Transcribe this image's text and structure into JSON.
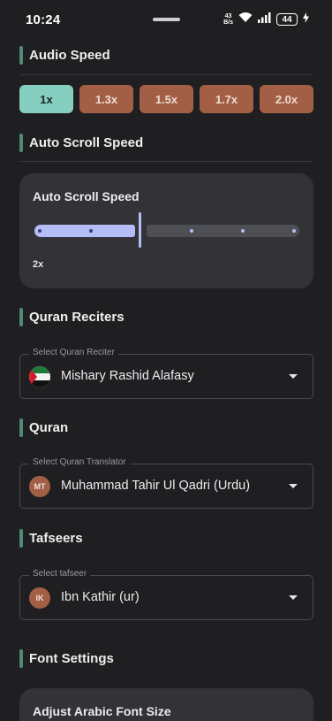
{
  "status_bar": {
    "time": "10:24",
    "net_speed_value": "43",
    "net_speed_unit": "B/s",
    "battery": "44"
  },
  "audio_speed": {
    "title": "Audio Speed",
    "options": [
      "1x",
      "1.3x",
      "1.5x",
      "1.7x",
      "2.0x"
    ],
    "selected": "1x"
  },
  "auto_scroll": {
    "section_title": "Auto Scroll Speed",
    "card_title": "Auto Scroll Speed",
    "value_label": "2x",
    "slider_fraction": 0.42
  },
  "quran_reciters": {
    "title": "Quran Reciters",
    "field_label": "Select Quran Reciter",
    "value": "Mishary Rashid Alafasy",
    "icon": "uae-flag-icon"
  },
  "quran": {
    "title": "Quran",
    "field_label": "Select Quran Translator",
    "value": "Muhammad Tahir Ul Qadri (Urdu)",
    "avatar": "MT"
  },
  "tafseers": {
    "title": "Tafseers",
    "field_label": "Select tafseer",
    "value": "Ibn Kathir (ur)",
    "avatar": "IK"
  },
  "font_settings": {
    "title": "Font Settings",
    "card_title": "Adjust Arabic Font Size"
  },
  "colors": {
    "background": "#1f1f21",
    "accent_bar": "#4f8a78",
    "chip_selected": "#86cfc0",
    "chip": "#a35f46",
    "slider_active": "#b4bdf5",
    "card": "#333337"
  }
}
